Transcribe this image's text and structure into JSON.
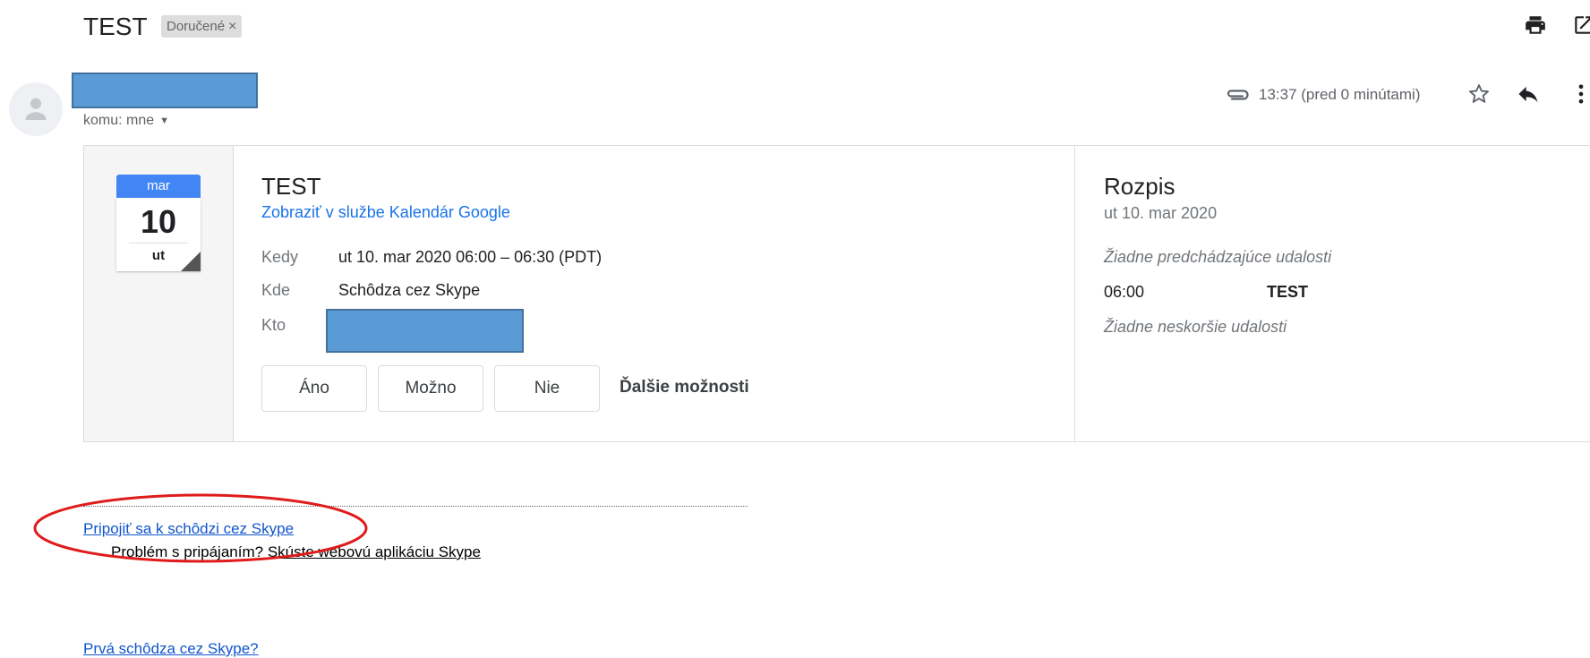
{
  "header": {
    "subject": "TEST",
    "label": "Doručené",
    "label_remove": "×"
  },
  "icons": {
    "print": "print-icon",
    "new_window": "open-in-new-window-icon",
    "attachment": "attachment-icon",
    "star": "star-icon",
    "reply": "reply-icon",
    "more": "more-vert-icon",
    "avatar": "person-icon"
  },
  "message": {
    "to_label": "komu: mne",
    "timestamp": "13:37 (pred 0 minútami)"
  },
  "invite": {
    "calendar_month": "mar",
    "calendar_day": "10",
    "calendar_weekday": "ut",
    "title": "TEST",
    "view_link": "Zobraziť v službe Kalendár Google",
    "rows": [
      {
        "label": "Kedy",
        "value": "ut 10. mar 2020 06:00 – 06:30 (PDT)"
      },
      {
        "label": "Kde",
        "value": "Schôdza cez Skype"
      },
      {
        "label": "Kto",
        "value": ""
      }
    ],
    "rsvp": {
      "yes": "Áno",
      "maybe": "Možno",
      "no": "Nie",
      "more": "Ďalšie možnosti"
    }
  },
  "agenda": {
    "title": "Rozpis",
    "date": "ut 10. mar 2020",
    "before": "Žiadne predchádzajúce udalosti",
    "event_time": "06:00",
    "event_name": "TEST",
    "after": "Žiadne neskoršie udalosti"
  },
  "skype": {
    "join_link": "Pripojiť sa k schôdzi cez Skype",
    "problem_text": "Problém s pripájaním?",
    "web_app_link": "Skúste webovú aplikáciu Skype",
    "first_meeting_link": "Prvá schôdza cez Skype?"
  },
  "colors": {
    "accent_blue": "#1a73e8",
    "calendar_header": "#4285f4",
    "redaction": "#5b9bd5",
    "annotation": "#e01b1b",
    "skype_link": "#1155cc"
  }
}
